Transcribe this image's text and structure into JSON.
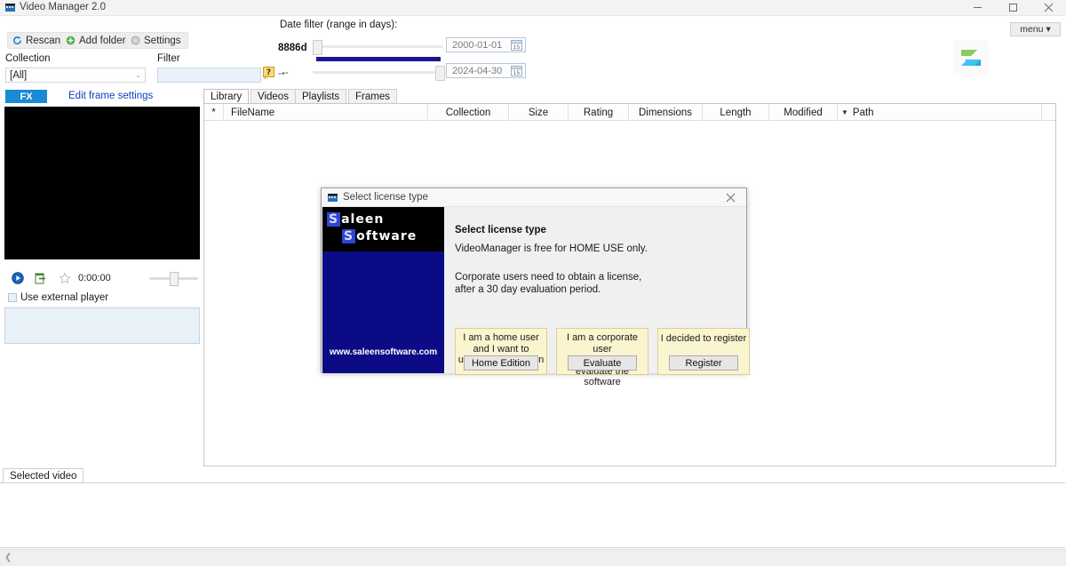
{
  "window": {
    "title": "Video Manager 2.0",
    "icon": "app-icon",
    "controls": {
      "minimize": "minimize-icon",
      "maximize": "maximize-icon",
      "close": "close-icon"
    }
  },
  "toolbar": {
    "rescan_label": "Rescan",
    "add_folder_label": "Add folder",
    "settings_label": "Settings",
    "menu_label": "menu",
    "menu_caret": "▾"
  },
  "filters": {
    "collection_label": "Collection",
    "collection_value": "[All]",
    "collection_caret": "⌄",
    "filter_label": "Filter",
    "filter_value": "",
    "filter_placeholder": "",
    "help_icon": "help-question-icon",
    "dash_left": "--",
    "date_filter_label": "Date filter (range in days):",
    "days_value": "8886d",
    "dash_right": "--",
    "date_from": "2000-01-01",
    "date_to": "2024-04-30",
    "calendar_icon_label": "15"
  },
  "preview": {
    "fx_label": "FX",
    "edit_frame_settings_label": "Edit frame settings",
    "play_icon": "play-icon",
    "export_icon": "export-icon",
    "star_icon": "star-icon",
    "timecode": "0:00:00",
    "use_external_player_label": "Use external player",
    "notes_value": ""
  },
  "tabs": [
    {
      "label": "Library",
      "active": true
    },
    {
      "label": "Videos",
      "active": false
    },
    {
      "label": "Playlists",
      "active": false
    },
    {
      "label": "Frames",
      "active": false
    }
  ],
  "table": {
    "columns": [
      {
        "label": "*",
        "align": "center"
      },
      {
        "label": "FileName",
        "align": "left"
      },
      {
        "label": "Collection",
        "align": "center"
      },
      {
        "label": "Size",
        "align": "center"
      },
      {
        "label": "Rating",
        "align": "center"
      },
      {
        "label": "Dimensions",
        "align": "center"
      },
      {
        "label": "Length",
        "align": "center"
      },
      {
        "label": "Modified",
        "align": "center",
        "sorted": true,
        "sort_caret": "▼"
      },
      {
        "label": "Path",
        "align": "left"
      },
      {
        "label": "",
        "align": "center"
      }
    ],
    "rows": []
  },
  "bottom": {
    "selected_video_tab": "Selected video",
    "status_chevron": "❮"
  },
  "dialog": {
    "title": "Select license type",
    "icon": "app-icon",
    "close_icon": "close-icon",
    "heading": "Select license type",
    "text_1": "VideoManager is free for HOME USE only.",
    "text_2": "Corporate users need to obtain a license,\nafter a 30 day evaluation period.",
    "brand": {
      "line1_cap": "S",
      "line1_rest": "aleen",
      "line2_cap": "S",
      "line2_rest": "oftware",
      "url": "www.saleensoftware.com"
    },
    "choices": [
      {
        "text": "I am a home user\nand I want to\nuse the free version",
        "button": "Home Edition"
      },
      {
        "text": "I am a corporate user\nand I want to\nevaluate the software",
        "button": "Evaluate"
      },
      {
        "text": "I decided to register",
        "button": "Register"
      }
    ]
  },
  "colors": {
    "accent_blue": "#1a8ad4",
    "link_blue": "#1042b8",
    "range_bar": "#181891",
    "brand_navy": "#0b0b86",
    "choice_bg": "#faf4cf"
  }
}
